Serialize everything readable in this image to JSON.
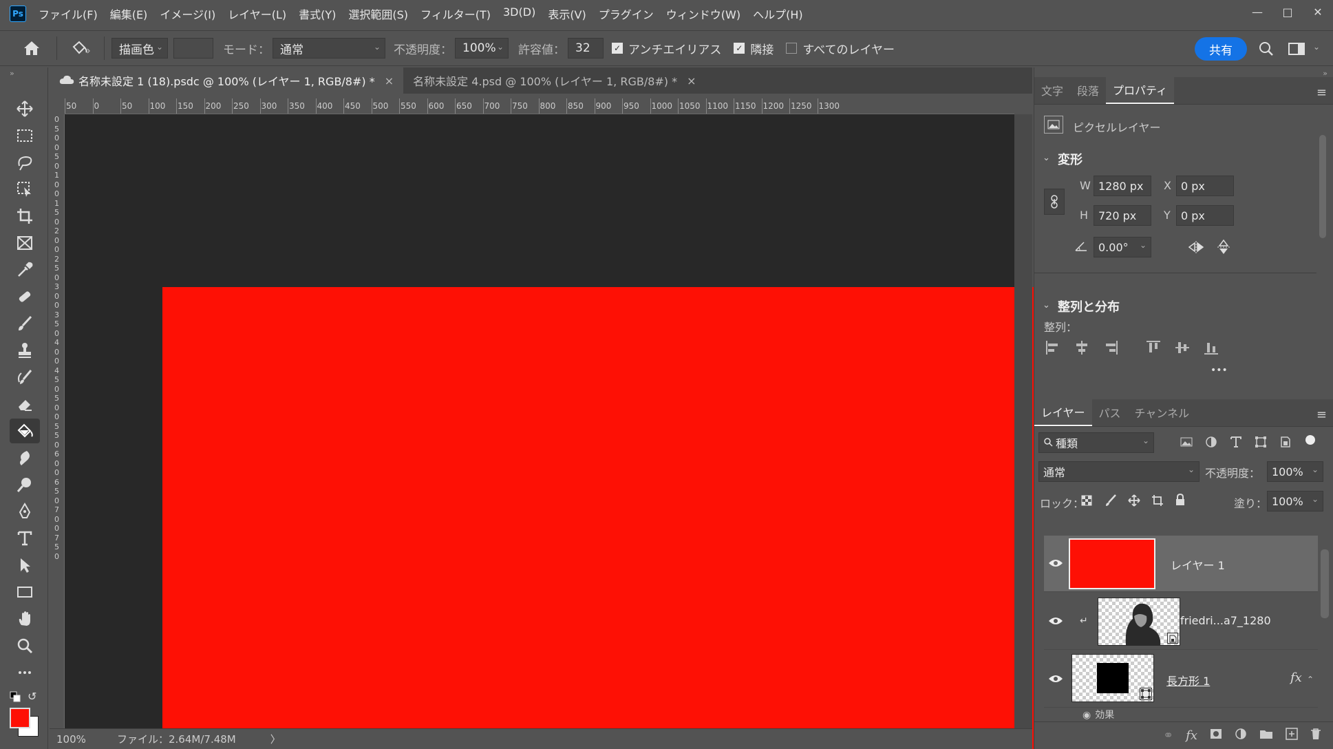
{
  "app": {
    "logo": "Ps"
  },
  "menu": [
    "ファイル(F)",
    "編集(E)",
    "イメージ(I)",
    "レイヤー(L)",
    "書式(Y)",
    "選択範囲(S)",
    "フィルター(T)",
    "3D(D)",
    "表示(V)",
    "プラグイン",
    "ウィンドウ(W)",
    "ヘルプ(H)"
  ],
  "options": {
    "fill_source": "描画色",
    "mode_label": "モード：",
    "mode_value": "通常",
    "opacity_label": "不透明度：",
    "opacity_value": "100%",
    "tolerance_label": "許容値：",
    "tolerance_value": "32",
    "antialias_label": "アンチエイリアス",
    "contiguous_label": "隣接",
    "all_layers_label": "すべてのレイヤー",
    "share_label": "共有"
  },
  "tabs": [
    {
      "label": "名称未設定 1 (18).psdc @ 100% (レイヤー 1, RGB/8#) *",
      "close": "×"
    },
    {
      "label": "名称未設定 4.psd @ 100% (レイヤー 1, RGB/8#) *",
      "close": "×"
    }
  ],
  "ruler": {
    "top": [
      "50",
      "0",
      "50",
      "100",
      "150",
      "200",
      "250",
      "300",
      "350",
      "400",
      "450",
      "500",
      "550",
      "600",
      "650",
      "700",
      "750",
      "800",
      "850",
      "900",
      "950",
      "1000",
      "1050",
      "1100",
      "1150",
      "1200",
      "1250",
      "1300"
    ],
    "left": [
      "0",
      "5",
      "0",
      "0",
      "5",
      "0",
      "1",
      "0",
      "0",
      "1",
      "5",
      "0",
      "2",
      "0",
      "0",
      "2",
      "5",
      "0",
      "3",
      "0",
      "0",
      "3",
      "5",
      "0",
      "4",
      "0",
      "0",
      "4",
      "5",
      "0",
      "5",
      "0",
      "0",
      "5",
      "5",
      "0",
      "6",
      "0",
      "0",
      "6",
      "5",
      "0",
      "7",
      "0",
      "0",
      "7",
      "5",
      "0"
    ]
  },
  "status": {
    "zoom": "100%",
    "file_info": "ファイル：2.64M/7.48M",
    "arrow": "〉"
  },
  "colors": {
    "foreground": "#fe1005",
    "background": "#ffffff",
    "canvas": "#fe1005"
  },
  "properties": {
    "tabs": [
      "文字",
      "段落",
      "プロパティ"
    ],
    "layer_type": "ピクセルレイヤー",
    "transform_title": "変形",
    "w_label": "W",
    "w_value": "1280 px",
    "x_label": "X",
    "x_value": "0 px",
    "h_label": "H",
    "h_value": "720 px",
    "y_label": "Y",
    "y_value": "0 px",
    "angle_value": "0.00°",
    "align_title": "整列と分布",
    "align_label": "整列：",
    "more": "•••"
  },
  "layers_panel": {
    "tabs": [
      "レイヤー",
      "パス",
      "チャンネル"
    ],
    "filter_label": "種類",
    "blend_mode": "通常",
    "opacity_label": "不透明度：",
    "opacity_value": "100%",
    "lock_label": "ロック：",
    "fill_label": "塗り：",
    "fill_value": "100%",
    "layers": [
      {
        "name": "レイヤー 1"
      },
      {
        "name": "friedri...a7_1280"
      },
      {
        "name": "長方形 1",
        "fx": "fx"
      }
    ],
    "effects_label": "効果"
  }
}
